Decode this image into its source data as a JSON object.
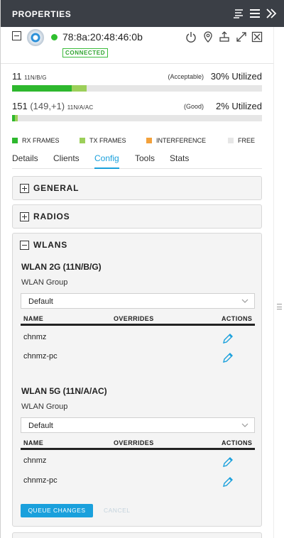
{
  "header": {
    "title": "PROPERTIES"
  },
  "device": {
    "mac": "78:8a:20:48:46:0b",
    "status": "CONNECTED"
  },
  "bands": [
    {
      "channel": "11",
      "mode": "11N/B/G",
      "quality": "(Acceptable)",
      "utilization": "30% Utilized",
      "segments": [
        {
          "type": "rx",
          "fraction": 0.24
        },
        {
          "type": "tx",
          "fraction": 0.06
        }
      ]
    },
    {
      "channel": "151",
      "extra": "(149,+1)",
      "mode": "11N/A/AC",
      "quality": "(Good)",
      "utilization": "2% Utilized",
      "segments": [
        {
          "type": "rx",
          "fraction": 0.01
        },
        {
          "type": "tx",
          "fraction": 0.01
        }
      ]
    }
  ],
  "legend": [
    "RX FRAMES",
    "TX FRAMES",
    "INTERFERENCE",
    "FREE"
  ],
  "colors": {
    "rx": "#2eb82e",
    "tx": "#9ccf5a",
    "interference": "#f3a13b",
    "free": "#e6e6e6",
    "accent": "#1aa0dc",
    "titlebar": "#3b3f46"
  },
  "tabs": [
    "Details",
    "Clients",
    "Config",
    "Tools",
    "Stats"
  ],
  "active_tab": "Config",
  "sections": {
    "general": "GENERAL",
    "radios": "RADIOS",
    "wlans": "WLANS"
  },
  "wlan_groups": [
    {
      "title": "WLAN 2G (11N/B/G)",
      "group_label": "WLAN Group",
      "selected": "Default",
      "columns": [
        "NAME",
        "OVERRIDES",
        "ACTIONS"
      ],
      "rows": [
        "chnmz",
        "chnmz-pc"
      ]
    },
    {
      "title": "WLAN 5G (11N/A/AC)",
      "group_label": "WLAN Group",
      "selected": "Default",
      "columns": [
        "NAME",
        "OVERRIDES",
        "ACTIONS"
      ],
      "rows": [
        "chnmz",
        "chnmz-pc"
      ]
    }
  ],
  "buttons": {
    "queue": "QUEUE CHANGES",
    "cancel": "CANCEL"
  },
  "icons": [
    "list-view-icon",
    "menu-icon",
    "collapse-panel-icon",
    "power-icon",
    "location-icon",
    "network-icon",
    "expand-icon",
    "close-icon",
    "edit-pencil-icon"
  ]
}
